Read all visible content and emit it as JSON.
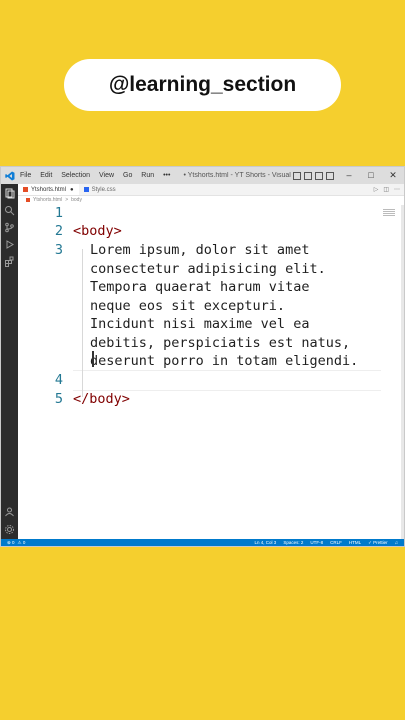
{
  "channel": {
    "handle": "@learning_section"
  },
  "window": {
    "menu": [
      "File",
      "Edit",
      "Selection",
      "View",
      "Go",
      "Run",
      "•••"
    ],
    "title": "• Ytshorts.html - YT Shorts - Visual Studio Code",
    "controls": {
      "minimize": "–",
      "maximize": "□",
      "close": "✕"
    }
  },
  "tabs": [
    {
      "label": "Ytshorts.html",
      "active": true,
      "dirty_marker": "●"
    },
    {
      "label": "Style.css",
      "active": false
    }
  ],
  "breadcrumb": {
    "file": "Ytshorts.html",
    "separator": ">",
    "node": "body"
  },
  "editor": {
    "line_numbers": [
      "1",
      "2",
      "3",
      "4",
      "5"
    ],
    "lines": {
      "l2_open": "<",
      "l2_tag": "body",
      "l2_close": ">",
      "l3a": "Lorem ipsum, dolor sit amet",
      "l3b": "consectetur adipisicing elit.",
      "l3c": "Tempora quaerat harum vitae",
      "l3d": "neque eos sit excepturi.",
      "l3e": "Incidunt nisi maxime vel ea",
      "l3f": "debitis, perspiciatis est natus,",
      "l3g": "deserunt porro in totam eligendi.",
      "l5_open": "</",
      "l5_tag": "body",
      "l5_close": ">"
    }
  },
  "statusbar": {
    "left": [
      "⊗ 0",
      "⚠ 0"
    ],
    "right": [
      "Ln 4, Col 3",
      "Spaces: 2",
      "UTF-8",
      "CRLF",
      "HTML",
      "✓ Prettier"
    ]
  },
  "colors": {
    "background": "#f5cf2e",
    "statusbar": "#007acc",
    "tag": "#800000",
    "line_number": "#237893"
  }
}
